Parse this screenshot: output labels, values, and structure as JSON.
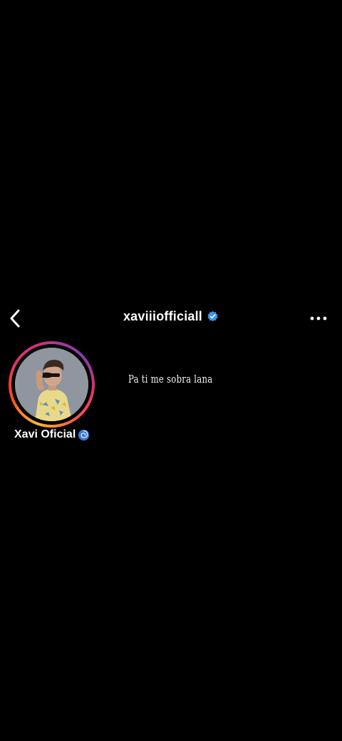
{
  "header": {
    "back_icon": "chevron-left-icon",
    "username": "xaviiiofficiall",
    "verified_icon": "verified-badge-icon",
    "more_icon": "more-horizontal-icon"
  },
  "profile": {
    "display_name": "Xavi Oficial",
    "emoji_icon": "cyclone-emoji-icon",
    "has_story_ring": true
  },
  "caption": {
    "text": "Pa ti me sobra lana"
  },
  "colors": {
    "background": "#000000",
    "verified_blue": "#3897f0",
    "text": "#ffffff"
  }
}
